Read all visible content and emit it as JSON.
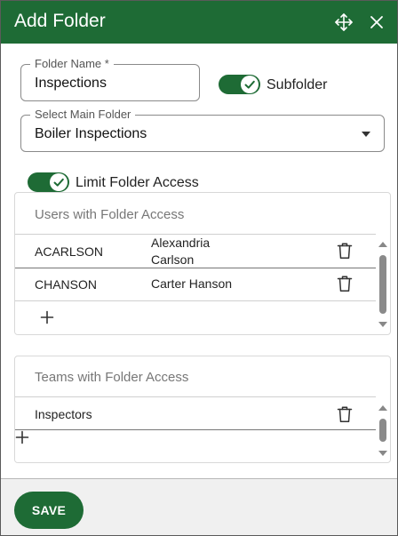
{
  "dialog": {
    "title": "Add Folder",
    "header_icons": [
      "move-icon",
      "close-icon"
    ],
    "accent_color": "#1e6b35"
  },
  "folder_name": {
    "label": "Folder Name *",
    "value": "Inspections"
  },
  "subfolder": {
    "label": "Subfolder",
    "enabled": true
  },
  "main_folder": {
    "label": "Select Main Folder",
    "value": "Boiler Inspections"
  },
  "limit_access": {
    "label": "Limit Folder Access",
    "enabled": true
  },
  "users_panel": {
    "header": "Users with Folder Access",
    "rows": [
      {
        "username": "ACARLSON",
        "name_line1": "Alexandria",
        "name_line2": "Carlson"
      },
      {
        "username": "CHANSON",
        "name_line1": "Carter Hanson",
        "name_line2": ""
      }
    ]
  },
  "teams_panel": {
    "header": "Teams with Folder Access",
    "rows": [
      {
        "team": "Inspectors"
      }
    ]
  },
  "footer": {
    "save_label": "SAVE"
  }
}
